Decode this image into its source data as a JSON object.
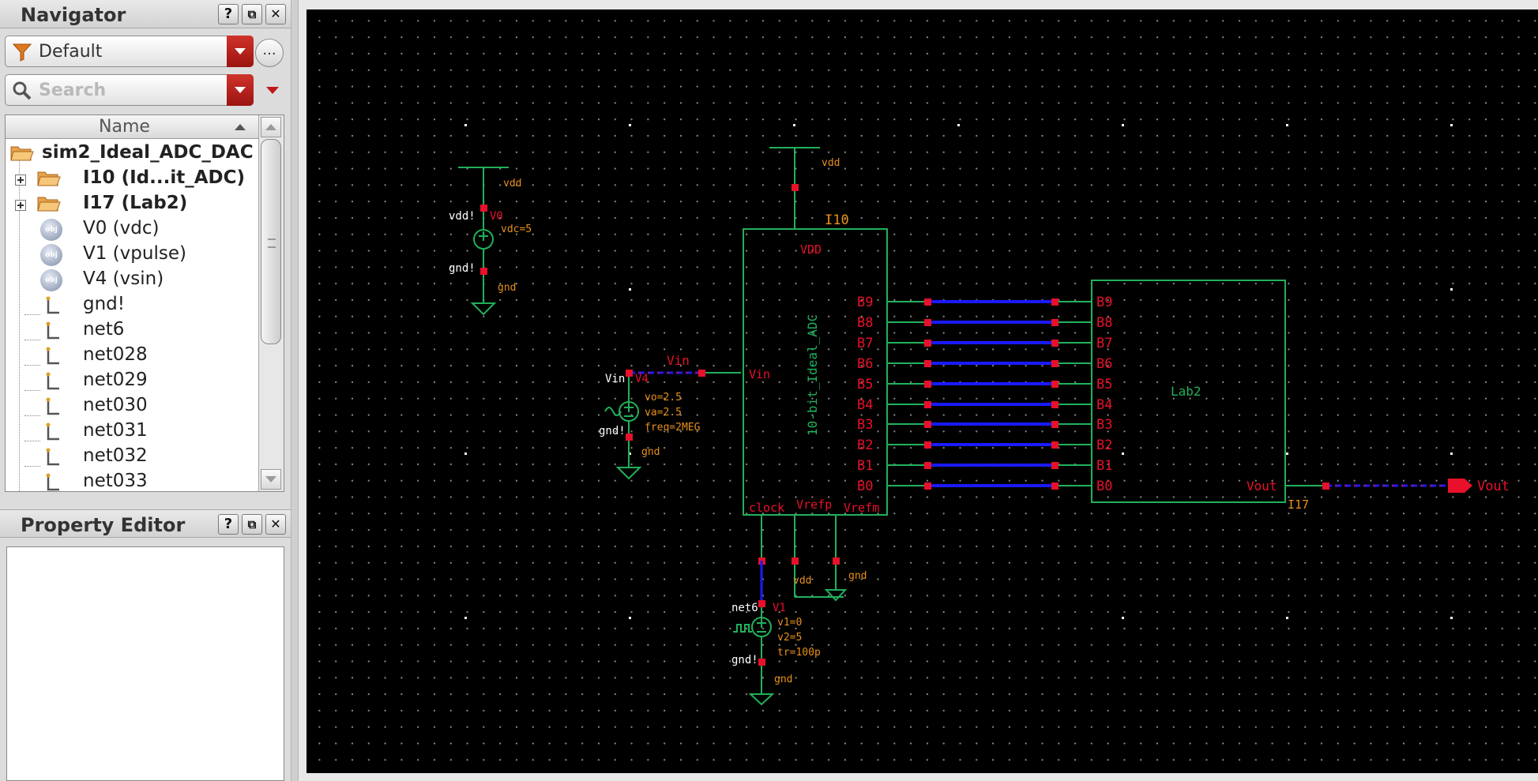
{
  "navigator": {
    "title": "Navigator",
    "filter_value": "Default",
    "more_label": "...",
    "search_placeholder": "Search",
    "column_header": "Name",
    "tree": {
      "root": "sim2_Ideal_ADC_DAC",
      "instances": [
        "I10 (Id...it_ADC)",
        "I17 (Lab2)"
      ],
      "objects": [
        "V0 (vdc)",
        "V1 (vpulse)",
        "V4 (vsin)"
      ],
      "object_icon_label": "obj",
      "nets": [
        "gnd!",
        "net6",
        "net028",
        "net029",
        "net030",
        "net031",
        "net032",
        "net033"
      ]
    },
    "buttons": {
      "help": "?",
      "float": "⧉",
      "close": "✕"
    }
  },
  "property_editor": {
    "title": "Property Editor"
  },
  "schematic": {
    "colors": {
      "background": "#000000",
      "wire": "#22b05a",
      "pin": "#e8102a",
      "bus": "#1a1aff",
      "label": "#e8102a",
      "param": "#e8901a",
      "text_white": "#ffffff"
    },
    "adc": {
      "instance": "I10",
      "cell": "10-bit_Ideal_ADC",
      "vdd_pin": "VDD",
      "vin_pin": "Vin",
      "clock_pin": "clock",
      "vrefp_pin": "Vrefp",
      "vrefm_pin": "Vrefm"
    },
    "dac": {
      "instance": "I17",
      "cell": "Lab2",
      "output_pin": "Vout"
    },
    "bits": [
      "B9",
      "B8",
      "B7",
      "B6",
      "B5",
      "B4",
      "B3",
      "B2",
      "B1",
      "B0"
    ],
    "output_port": "Vout",
    "input_net": "Vin",
    "sources": {
      "v0": {
        "name": "V0",
        "top_net": "vdd!",
        "params": [
          "vdc=5"
        ],
        "bottom_net": "gnd!"
      },
      "v4": {
        "name": "V4",
        "top_net": "Vin",
        "params": [
          "vo=2.5",
          "va=2.5",
          "freq=2MEG"
        ],
        "bottom_net": "gnd!"
      },
      "v1": {
        "name": "V1",
        "top_net": "net6",
        "params": [
          "v1=0",
          "v2=5",
          "tr=100p"
        ],
        "bottom_net": "gnd!"
      }
    },
    "net_labels": {
      "vdd": "vdd",
      "gnd": "gnd"
    }
  }
}
